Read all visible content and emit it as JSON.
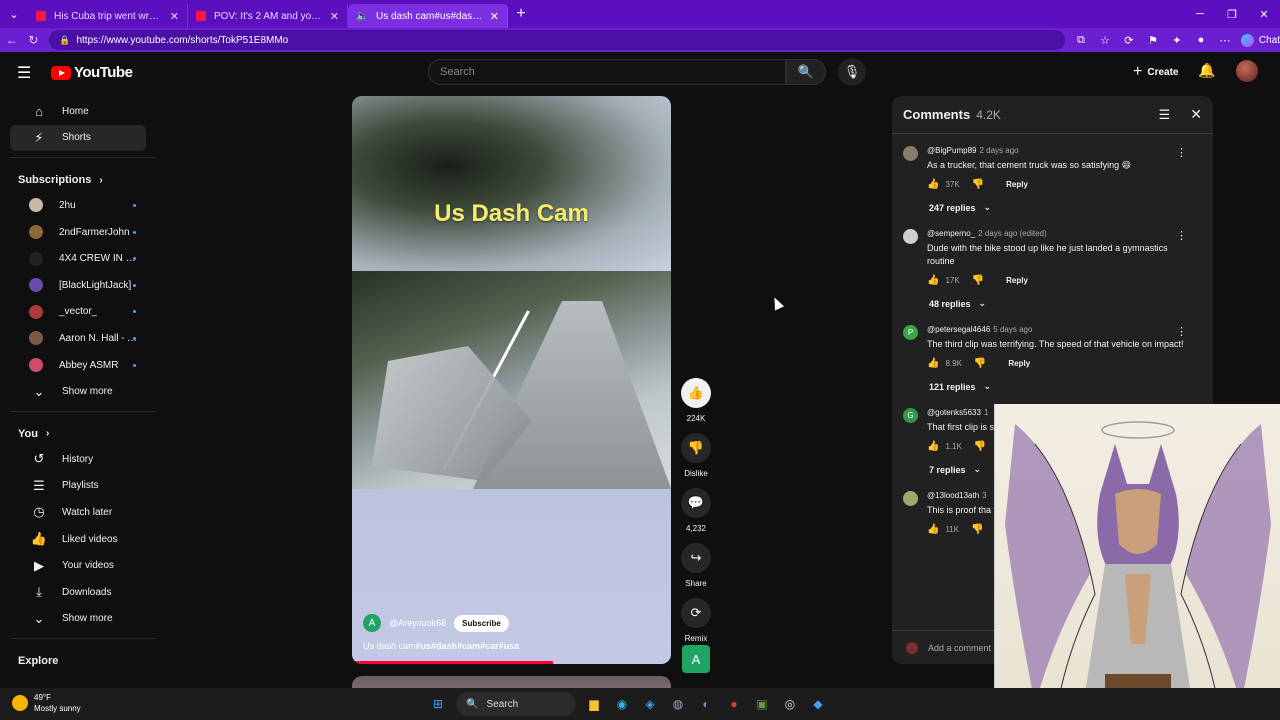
{
  "browser": {
    "tabs": [
      {
        "title": "His Cuba trip went wrong... - YouTube",
        "active": false
      },
      {
        "title": "POV: It's 2 AM and you have the ...",
        "active": false
      },
      {
        "title": "Us dash cam#us#dash#cam#...",
        "active": true
      }
    ],
    "url": "https://www.youtube.com/shorts/TokP51E8MMo",
    "chat_label": "Chat"
  },
  "masthead": {
    "logo_text": "YouTube",
    "search_placeholder": "Search",
    "create_label": "Create"
  },
  "sidebar": {
    "main": [
      {
        "label": "Home",
        "icon": "home-icon"
      },
      {
        "label": "Shorts",
        "icon": "shorts-icon",
        "selected": true
      }
    ],
    "subscriptions_title": "Subscriptions",
    "subscriptions": [
      {
        "label": "2hu",
        "color": "#c9b9a6"
      },
      {
        "label": "2ndFarmerJohn",
        "color": "#8a6a3a"
      },
      {
        "label": "4X4 CREW IN PU...",
        "color": "#222222"
      },
      {
        "label": "[BlackLightJack]",
        "color": "#6a4aa8"
      },
      {
        "label": "_vector_",
        "color": "#b03a3a"
      },
      {
        "label": "Aaron N. Hall - A...",
        "color": "#7a5a44"
      },
      {
        "label": "Abbey ASMR",
        "color": "#d04a6a"
      }
    ],
    "show_more_1": "Show more",
    "you_title": "You",
    "you_items": [
      {
        "label": "History",
        "icon": "history-icon"
      },
      {
        "label": "Playlists",
        "icon": "playlists-icon"
      },
      {
        "label": "Watch later",
        "icon": "watch-later-icon"
      },
      {
        "label": "Liked videos",
        "icon": "liked-videos-icon"
      },
      {
        "label": "Your videos",
        "icon": "your-videos-icon"
      },
      {
        "label": "Downloads",
        "icon": "downloads-icon"
      }
    ],
    "show_more_2": "Show more",
    "explore_title": "Explore"
  },
  "short": {
    "overlay_title": "Us Dash Cam",
    "channel_initial": "A",
    "channel": "@Areyouok68",
    "subscribe_label": "Subscribe",
    "caption_plain": "Us dash cam",
    "caption_tags": "#us#dash#cam#car#usa",
    "progress": 0.63
  },
  "actions": {
    "likes": "224K",
    "dislike_label": "Dislike",
    "comments": "4,232",
    "share_label": "Share",
    "remix_label": "Remix",
    "remix_initial": "A"
  },
  "comments": {
    "title": "Comments",
    "count": "4.2K",
    "items": [
      {
        "author": "@BigPump89",
        "ago": "2 days ago",
        "text": "As a trucker, that cement truck was so satisfying 😄",
        "likes": "37K",
        "replies": "247 replies",
        "color": "#8a7a6a"
      },
      {
        "author": "@semperno_",
        "ago": "2 days ago (edited)",
        "text": "Dude with the bike stood up like he just landed a gymnastics routine",
        "likes": "17K",
        "replies": "48 replies",
        "color": "#cfcfcf"
      },
      {
        "author": "@petersegal4646",
        "ago": "5 days ago",
        "text": "The third clip was terrifying. The speed of that vehicle on impact!",
        "likes": "8.9K",
        "replies": "121 replies",
        "color": "#3aa64a",
        "initial": "P"
      },
      {
        "author": "@gotenks5633",
        "ago": "1",
        "text": "That first clip is sometimes miss theirs",
        "likes": "1.1K",
        "replies": "7 replies",
        "color": "#2f9a4a",
        "initial": "G"
      },
      {
        "author": "@13lood13ath",
        "ago": "3",
        "text": "This is proof tha their license.",
        "likes": "11K",
        "color": "#9aaa6a"
      }
    ],
    "reply_label": "Reply",
    "add_placeholder": "Add a comment"
  },
  "taskbar": {
    "temp": "49°F",
    "condition": "Mostly sunny",
    "search_label": "Search"
  }
}
